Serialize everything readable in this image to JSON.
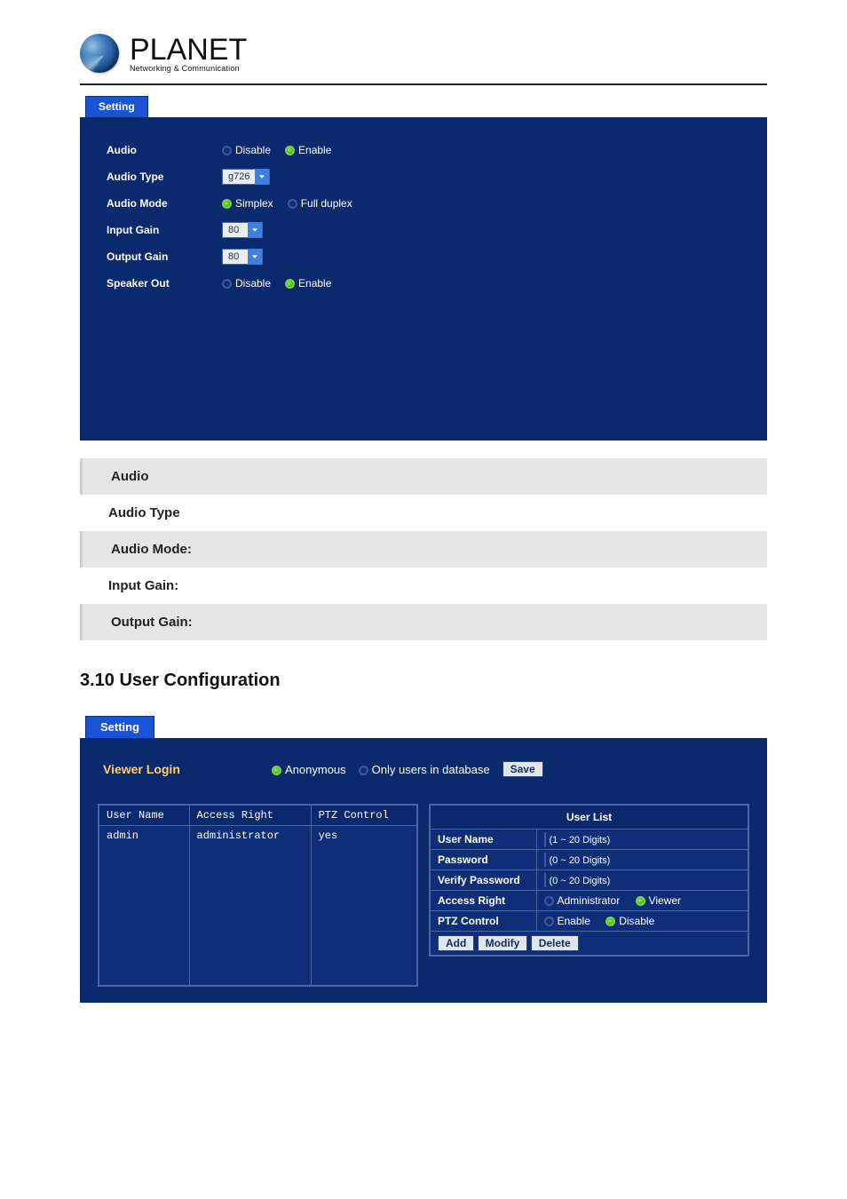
{
  "logo": {
    "main": "PLANET",
    "sub": "Networking & Communication"
  },
  "audio_panel": {
    "tab": "Setting",
    "rows": {
      "audio": {
        "label": "Audio",
        "opt1": "Disable",
        "opt2": "Enable",
        "selected": 2
      },
      "audio_type": {
        "label": "Audio Type",
        "value": "g726"
      },
      "audio_mode": {
        "label": "Audio Mode",
        "opt1": "Simplex",
        "opt2": "Full duplex",
        "selected": 1
      },
      "input_gain": {
        "label": "Input Gain",
        "value": "80"
      },
      "output_gain": {
        "label": "Output Gain",
        "value": "80"
      },
      "speaker_out": {
        "label": "Speaker Out",
        "opt1": "Disable",
        "opt2": "Enable",
        "selected": 2
      }
    }
  },
  "bands": {
    "b1": "Audio",
    "b2": "Audio Type",
    "b3": "Audio Mode:",
    "b4": "Input Gain:",
    "b5": "Output Gain:"
  },
  "section_heading": "3.10 User Configuration",
  "user_panel": {
    "tab": "Setting",
    "viewer_login_label": "Viewer Login",
    "viewer_opts": {
      "opt1": "Anonymous",
      "opt2": "Only users in database",
      "selected": 1
    },
    "save_btn": "Save",
    "left_table": {
      "headers": {
        "c1": "User Name",
        "c2": "Access Right",
        "c3": "PTZ Control"
      },
      "row": {
        "c1": "admin",
        "c2": "administrator",
        "c3": "yes"
      }
    },
    "user_list": {
      "title": "User List",
      "user_name": {
        "label": "User Name",
        "hint": "(1 ~ 20 Digits)"
      },
      "password": {
        "label": "Password",
        "hint": "(0 ~ 20 Digits)"
      },
      "verify_password": {
        "label": "Verify Password",
        "hint": "(0 ~ 20 Digits)"
      },
      "access_right": {
        "label": "Access Right",
        "opt1": "Administrator",
        "opt2": "Viewer",
        "selected": 2
      },
      "ptz_control": {
        "label": "PTZ Control",
        "opt1": "Enable",
        "opt2": "Disable",
        "selected": 2
      },
      "buttons": {
        "add": "Add",
        "modify": "Modify",
        "delete": "Delete"
      }
    }
  }
}
